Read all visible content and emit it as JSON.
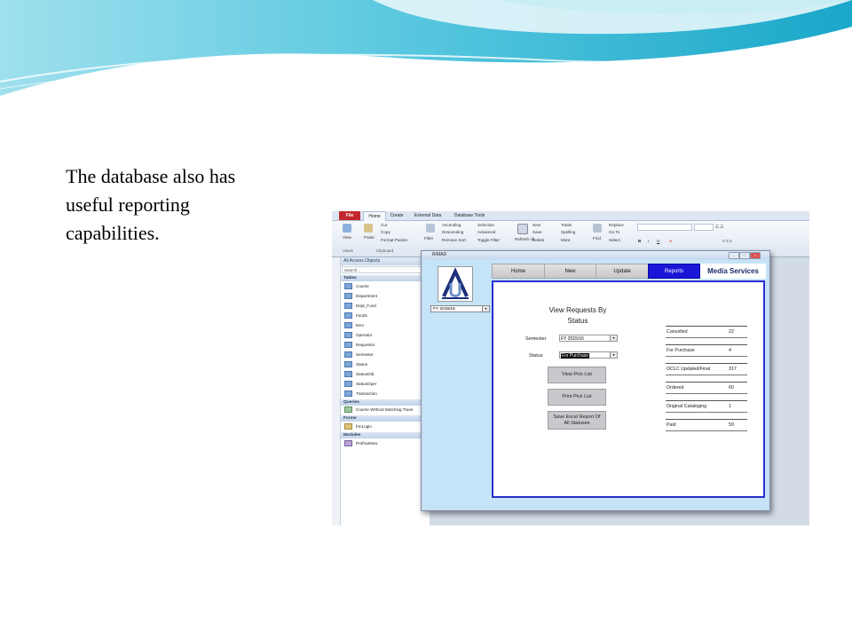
{
  "caption": {
    "line1": "The database also has",
    "line2": "useful reporting",
    "line3": "capabilities."
  },
  "ribbon": {
    "tabs": [
      "File",
      "Home",
      "Create",
      "External Data",
      "Database Tools"
    ],
    "views_button": "View",
    "paste_button": "Paste",
    "cut": "Cut",
    "copy": "Copy",
    "format_painter": "Format Painter",
    "filter_button": "Filter",
    "ascending": "Ascending",
    "descending": "Descending",
    "remove_sort": "Remove Sort",
    "selection": "Selection",
    "advanced": "Advanced",
    "toggle_filter": "Toggle Filter",
    "refresh": "Refresh All",
    "new": "New",
    "save": "Save",
    "delete": "Delete",
    "totals": "Totals",
    "spelling": "Spelling",
    "more": "More",
    "find": "Find",
    "replace": "Replace",
    "goto": "Go To",
    "select": "Select",
    "groups": {
      "views": "Views",
      "clipboard": "Clipboard"
    }
  },
  "nav": {
    "title": "All Access Objects",
    "search_placeholder": "Search...",
    "sections": {
      "tables": "Tables",
      "queries": "Queries",
      "forms": "Forms",
      "modules": "Modules"
    },
    "tables": [
      "Course",
      "Department",
      "Dept_Fund",
      "Funds",
      "Item",
      "Operator",
      "Requestor",
      "Semester",
      "Status",
      "StatusOld",
      "StatusOper",
      "Transaction"
    ],
    "queries": [
      "Course Without Matching Trans"
    ],
    "forms": [
      "frmLogin"
    ],
    "modules": [
      "ProfVarNew"
    ]
  },
  "form": {
    "window_title": "R/MAD",
    "fy_left": "FY 2015/16",
    "tabs": [
      "Home",
      "New",
      "Update",
      "Reports"
    ],
    "selected_tab": "Reports",
    "brand": "Media Services",
    "view_title_line1": "View Requests By",
    "view_title_line2": "Status",
    "semester_label": "Semester",
    "semester_value": "FY 2015/16",
    "status_label": "Status",
    "status_value": "For Purchase",
    "buttons": {
      "view_pick_list": "View Pick List",
      "print_pick_list": "Print Pick List",
      "save_excel": "Save Excel Report Of All Statuses"
    },
    "stats": [
      {
        "label": "Cancelled",
        "value": "22"
      },
      {
        "label": "For Purchase",
        "value": "4"
      },
      {
        "label": "OCLC Updated/Final",
        "value": "317"
      },
      {
        "label": "Ordered",
        "value": "60"
      },
      {
        "label": "Original Cataloging",
        "value": "1"
      },
      {
        "label": "Paid",
        "value": "59"
      }
    ]
  },
  "colors": {
    "reports_tab": "#1a16d8",
    "panel_border": "#2b2fd0",
    "form_background": "#c5e4f7",
    "wave_teal": "#3fbcd6"
  }
}
